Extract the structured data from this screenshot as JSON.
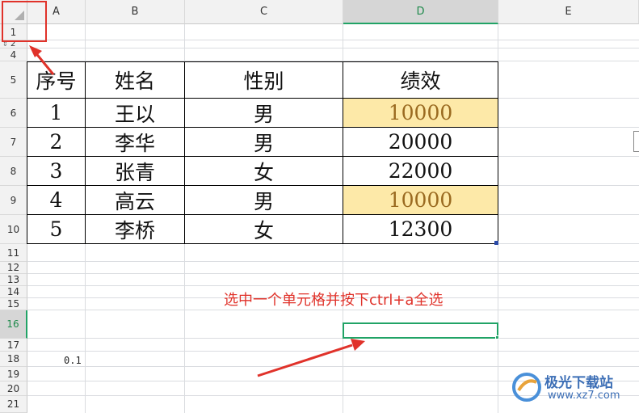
{
  "columns": [
    "A",
    "B",
    "C",
    "D",
    "E"
  ],
  "rows": [
    "1",
    "2",
    "4",
    "5",
    "6",
    "7",
    "8",
    "9",
    "10",
    "11",
    "12",
    "13",
    "14",
    "15",
    "16",
    "17",
    "18",
    "19",
    "20",
    "21"
  ],
  "table": {
    "headers": [
      "序号",
      "姓名",
      "性别",
      "绩效"
    ],
    "rows": [
      [
        "1",
        "王以",
        "男",
        "10000"
      ],
      [
        "2",
        "李华",
        "男",
        "20000"
      ],
      [
        "3",
        "张青",
        "女",
        "22000"
      ],
      [
        "4",
        "高云",
        "男",
        "10000"
      ],
      [
        "5",
        "李桥",
        "女",
        "12300"
      ]
    ]
  },
  "stray_value": "0.1",
  "annotation": "选中一个单元格并按下ctrl+a全选",
  "watermark": {
    "title": "极光下载站",
    "url": "www.xz7.com"
  },
  "colors": {
    "highlight": "#fde9a8",
    "selection": "#21a366",
    "annotation": "#e0322a"
  }
}
